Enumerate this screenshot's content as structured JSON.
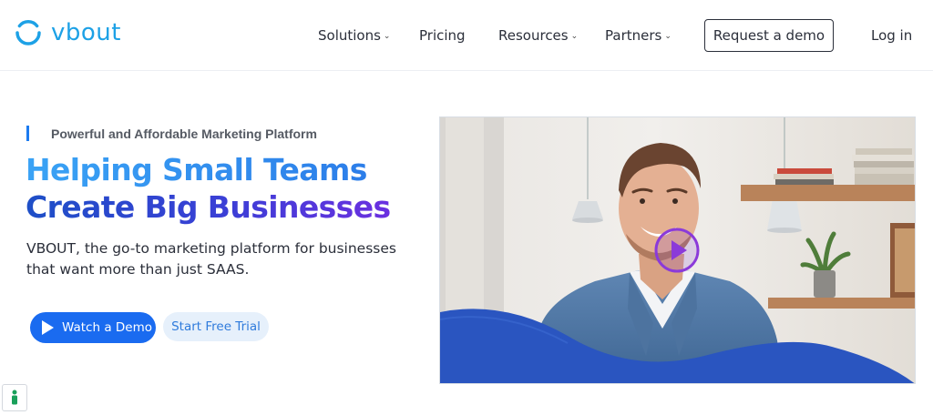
{
  "brand": {
    "name": "vbout",
    "color": "#1da1e6"
  },
  "nav": {
    "solutions": "Solutions",
    "pricing": "Pricing",
    "resources": "Resources",
    "partners": "Partners",
    "request_demo": "Request a demo",
    "login": "Log in"
  },
  "hero": {
    "tagline": "Powerful and Affordable Marketing Platform",
    "headline_line1": "Helping Small Teams",
    "headline_line2": "Create Big Businesses",
    "description": "VBOUT, the go-to marketing platform for businesses that want more than just SAAS.",
    "watch_demo": "Watch a Demo",
    "free_trial": "Start Free Trial"
  },
  "icons": {
    "logo": "vbout-logo-icon",
    "dropdown": "chevron-down-icon",
    "play": "play-icon",
    "video_play": "video-play-icon",
    "widget": "accessibility-icon"
  },
  "colors": {
    "primary": "#1a6bf0",
    "headline_start": "#3aa3f5",
    "headline_end": "#6b2fe0",
    "wave": "#2a55c0"
  }
}
